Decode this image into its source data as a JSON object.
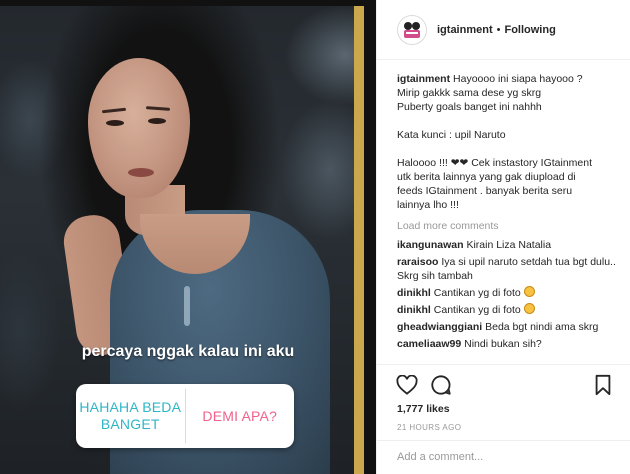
{
  "story": {
    "overlay_text": "percaya nggak kalau ini aku",
    "poll_option_a": "HAHAHA BEDA BANGET",
    "poll_option_b": "DEMI APA?"
  },
  "header": {
    "username": "igtainment",
    "separator": "•",
    "follow_status": "Following"
  },
  "caption": {
    "username": "igtainment",
    "lines": [
      "Hayoooo ini siapa hayooo ?",
      "Mirip gakkk sama dese yg skrg",
      "Puberty goals banget ini nahhh",
      "",
      "Kata kunci : upil Naruto",
      "",
      "Haloooo !!! ❤❤ Cek instastory IGtainment",
      "utk berita lainnya yang gak diupload di",
      "feeds IGtainment . banyak berita seru",
      "lainnya lho !!!"
    ]
  },
  "load_more": "Load more comments",
  "comments": [
    {
      "user": "ikangunawan",
      "text": "Kirain Liza Natalia"
    },
    {
      "user": "raraisoo",
      "text": "Iya si upil naruto setdah tua bgt dulu.. Skrg sih tambah"
    },
    {
      "user": "dinikhl",
      "text": "Cantikan yg di foto"
    },
    {
      "user": "dinikhl",
      "text": "Cantikan yg di foto"
    },
    {
      "user": "gheadwianggiani",
      "text": "Beda bgt nindi ama skrg"
    },
    {
      "user": "cameliaaw99",
      "text": "Nindi bukan sih?"
    }
  ],
  "likes": "1,777 likes",
  "time": "21 HOURS AGO",
  "add_comment_placeholder": "Add a comment...",
  "icons": {
    "like": "heart-icon",
    "comment": "comment-icon",
    "save": "bookmark-icon",
    "emoji": "laughing-face-emoji"
  }
}
